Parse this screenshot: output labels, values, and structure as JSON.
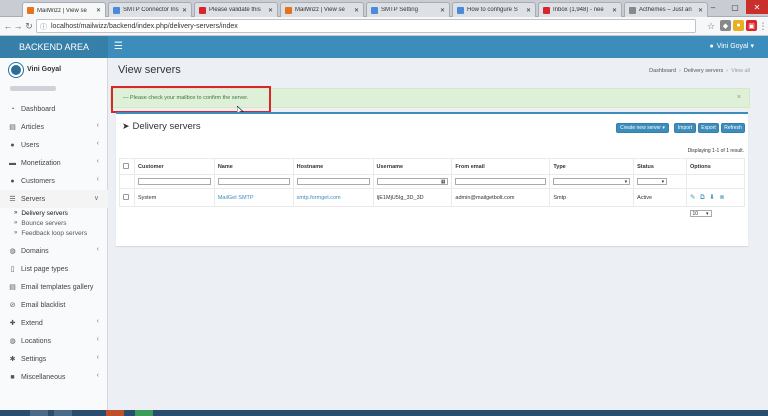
{
  "browser": {
    "tabs": [
      {
        "label": "MailWizz | View se",
        "color": "#e8711c",
        "active": true
      },
      {
        "label": "SMTP Connector Ins",
        "color": "#4a89dc",
        "active": false
      },
      {
        "label": "Please validate this",
        "color": "#d9262b",
        "active": false
      },
      {
        "label": "MailWizz | View se",
        "color": "#e8711c",
        "active": false
      },
      {
        "label": "SMTP Setting",
        "color": "#4a89dc",
        "active": false
      },
      {
        "label": "How to configure S",
        "color": "#4a89dc",
        "active": false
      },
      {
        "label": "Inbox (1,948) - nee",
        "color": "#d9262b",
        "active": false
      },
      {
        "label": "Acthemes – Just an",
        "color": "#888888",
        "active": false
      }
    ],
    "url": "localhost/mailwizz/backend/index.php/delivery-servers/index"
  },
  "header": {
    "logo": "BACKEND AREA",
    "user": "Vini Goyal"
  },
  "sidebar": {
    "user_name": "Vini Goyal",
    "items": [
      {
        "label": "Dashboard",
        "icon": "dashboard-icon",
        "glyph": "◔",
        "chevron": false
      },
      {
        "label": "Articles",
        "icon": "book-icon",
        "glyph": "▤",
        "chevron": true
      },
      {
        "label": "Users",
        "icon": "users-icon",
        "glyph": "●",
        "chevron": true
      },
      {
        "label": "Monetization",
        "icon": "money-icon",
        "glyph": "▬",
        "chevron": true
      },
      {
        "label": "Customers",
        "icon": "customers-icon",
        "glyph": "●",
        "chevron": true
      },
      {
        "label": "Servers",
        "icon": "servers-icon",
        "glyph": "☰",
        "chevron": true
      }
    ],
    "servers_sub": [
      {
        "label": "Delivery servers",
        "active": true
      },
      {
        "label": "Bounce servers",
        "active": false
      },
      {
        "label": "Feedback loop servers",
        "active": false
      }
    ],
    "items_after": [
      {
        "label": "Domains",
        "icon": "globe-icon",
        "glyph": "◍",
        "chevron": true
      },
      {
        "label": "List page types",
        "icon": "file-icon",
        "glyph": "▯",
        "chevron": false
      },
      {
        "label": "Email templates gallery",
        "icon": "template-icon",
        "glyph": "▤",
        "chevron": false
      },
      {
        "label": "Email blacklist",
        "icon": "ban-icon",
        "glyph": "⊘",
        "chevron": false
      },
      {
        "label": "Extend",
        "icon": "extend-icon",
        "glyph": "✚",
        "chevron": true
      },
      {
        "label": "Locations",
        "icon": "globe-icon",
        "glyph": "◍",
        "chevron": true
      },
      {
        "label": "Settings",
        "icon": "gear-icon",
        "glyph": "✱",
        "chevron": true
      },
      {
        "label": "Miscellaneous",
        "icon": "misc-icon",
        "glyph": "■",
        "chevron": true
      }
    ]
  },
  "content": {
    "page_title": "View servers",
    "breadcrumb": [
      "Dashboard",
      "Delivery servers",
      "View all"
    ],
    "alert": "— Please check your mailbox to confirm the server.",
    "box_title": "Delivery servers",
    "buttons": [
      "Create new server ▾",
      "Import",
      "Export",
      "Refresh"
    ],
    "table_info": "Displaying 1-1 of 1 result.",
    "columns": [
      "Customer",
      "Name",
      "Hostname",
      "Username",
      "From email",
      "Type",
      "Status",
      "Options"
    ],
    "row": {
      "customer": "System",
      "name": "MailGet SMTP",
      "hostname": "smtp.formget.com",
      "username": "IjE1MjU5Ig_3D_3D",
      "from_email": "admin@mailgetbolt.com",
      "type": "Smtp",
      "status": "Active"
    },
    "page_size": "10"
  }
}
